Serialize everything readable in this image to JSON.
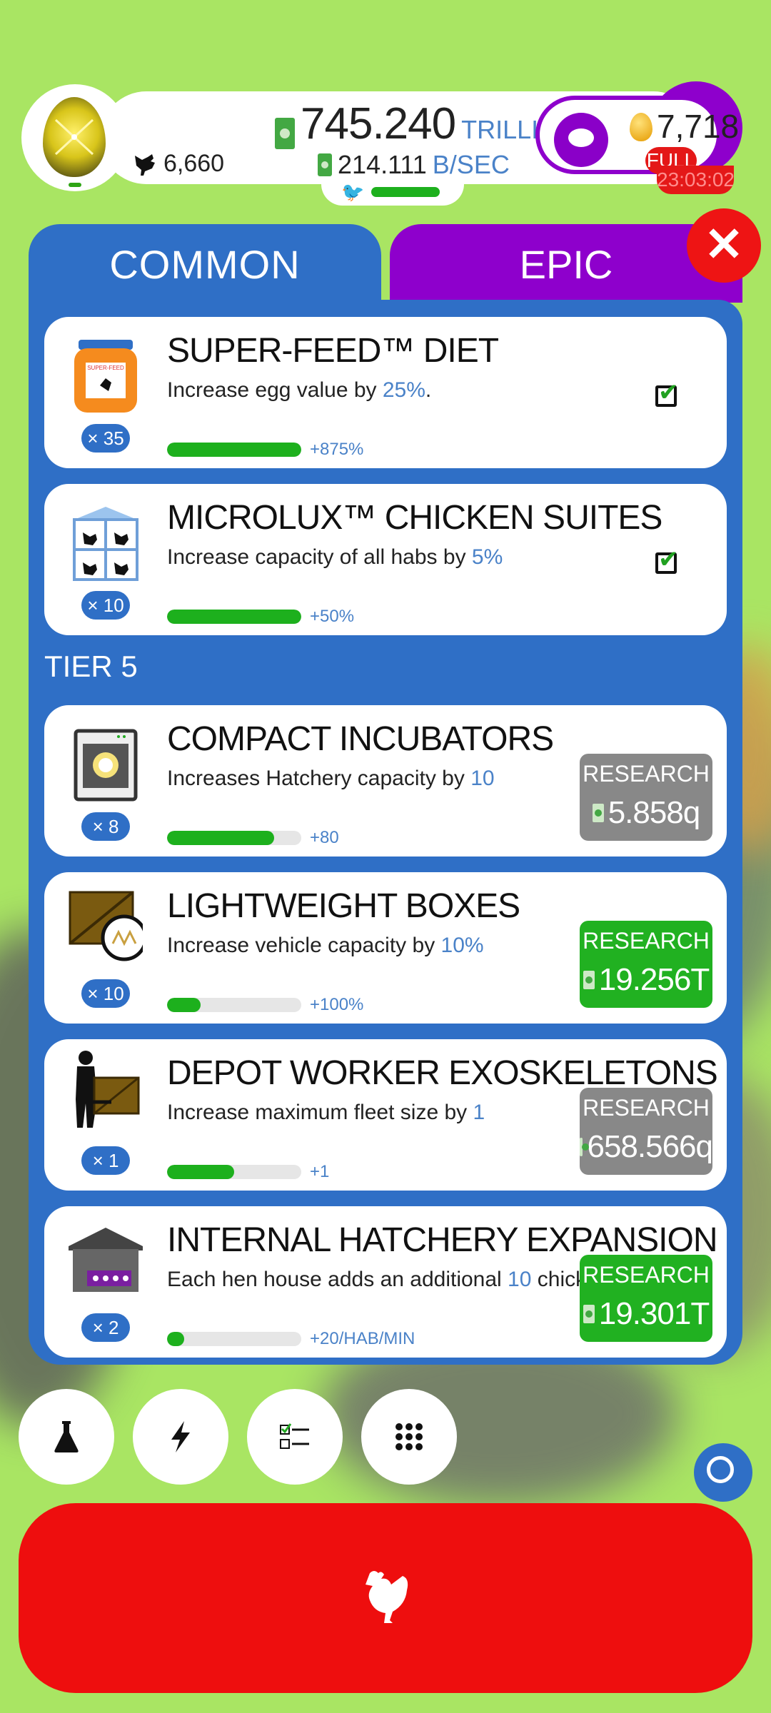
{
  "header": {
    "chicken_count": "6,660",
    "money_value": "745.240",
    "money_unit": "TRILLION",
    "rate_value": "214.111",
    "rate_unit": "B/SEC",
    "golden_eggs": "7,718",
    "piggy_status": "FULL",
    "timer": "23:03:02"
  },
  "tabs": {
    "common": "COMMON",
    "epic": "EPIC",
    "close": "✕"
  },
  "research": {
    "tier_label": "TIER 5",
    "button_label": "RESEARCH",
    "items": [
      {
        "title": "SUPER-FEED™ DIET",
        "desc_prefix": "Increase egg value by ",
        "desc_value": "25%",
        "desc_suffix": ".",
        "level": "× 35",
        "progress_label": "+875%",
        "progress": 1.0,
        "status": "complete"
      },
      {
        "title": "MICROLUX™ CHICKEN SUITES",
        "desc_prefix": "Increase capacity of all habs by ",
        "desc_value": "5%",
        "desc_suffix": "",
        "level": "× 10",
        "progress_label": "+50%",
        "progress": 1.0,
        "status": "complete"
      },
      {
        "title": "COMPACT INCUBATORS",
        "desc_prefix": "Increases Hatchery capacity by ",
        "desc_value": "10",
        "desc_suffix": "",
        "level": "× 8",
        "progress_label": "+80",
        "progress": 0.8,
        "cost": "5.858q",
        "affordable": false
      },
      {
        "title": "LIGHTWEIGHT BOXES",
        "desc_prefix": "Increase vehicle capacity by ",
        "desc_value": "10%",
        "desc_suffix": "",
        "level": "× 10",
        "progress_label": "+100%",
        "progress": 0.25,
        "cost": "19.256T",
        "affordable": true
      },
      {
        "title": "DEPOT WORKER EXOSKELETONS",
        "desc_prefix": "Increase maximum fleet size by ",
        "desc_value": "1",
        "desc_suffix": "",
        "level": "× 1",
        "progress_label": "+1",
        "progress": 0.5,
        "cost": "658.566q",
        "affordable": false
      },
      {
        "title": "INTERNAL HATCHERY EXPANSION",
        "desc_prefix": "Each hen house adds an additional ",
        "desc_value": "10",
        "desc_suffix": " chickens/min",
        "level": "× 2",
        "progress_label": "+20/HAB/MIN",
        "progress": 0.13,
        "cost": "19.301T",
        "affordable": true
      }
    ]
  },
  "toolbar": {
    "icons": [
      "flask-icon",
      "lightning-icon",
      "checklist-icon",
      "grid-icon"
    ]
  },
  "colors": {
    "panel_blue": "#2f6fc6",
    "epic_purple": "#8e00cc",
    "hatch_red": "#ee0e0e",
    "progress_green": "#1db01d",
    "highlight_blue": "#4a82c8"
  }
}
